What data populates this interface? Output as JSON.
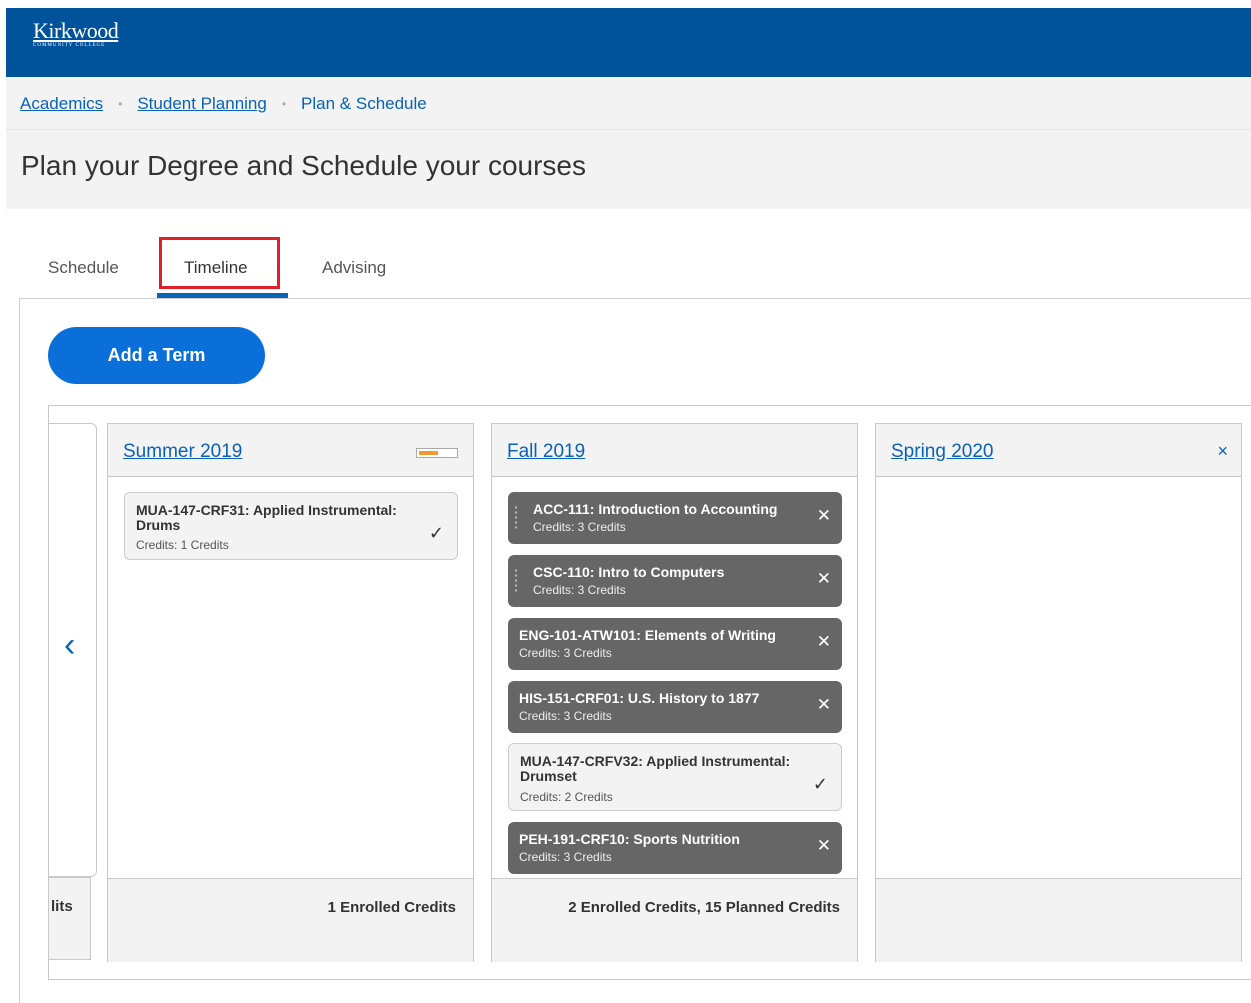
{
  "header": {
    "logo_name": "Kirkwood",
    "logo_sub": "COMMUNITY COLLEGE"
  },
  "breadcrumb": {
    "items": [
      "Academics",
      "Student Planning",
      "Plan & Schedule"
    ]
  },
  "page": {
    "title": "Plan your Degree and Schedule your courses"
  },
  "tabs": [
    {
      "label": "Schedule"
    },
    {
      "label": "Timeline",
      "selected": true
    },
    {
      "label": "Advising"
    }
  ],
  "actions": {
    "add_term": "Add a Term"
  },
  "prev_term": {
    "footer": "lits",
    "arrow_icon": "chevron-left-icon"
  },
  "terms": [
    {
      "name": "Summer 2019",
      "footer": "1 Enrolled Credits",
      "progress_fraction": 0.5,
      "courses": [
        {
          "title": "MUA-147-CRF31: Applied Instrumental: Drums",
          "credits": "Credits: 1 Credits",
          "status": "enrolled"
        }
      ]
    },
    {
      "name": "Fall 2019",
      "footer": "2 Enrolled Credits, 15 Planned Credits",
      "courses": [
        {
          "title": "ACC-111: Introduction to Accounting",
          "credits": "Credits: 3 Credits",
          "status": "planned"
        },
        {
          "title": "CSC-110: Intro to Computers",
          "credits": "Credits: 3 Credits",
          "status": "planned"
        },
        {
          "title": "ENG-101-ATW101: Elements of Writing",
          "credits": "Credits: 3 Credits",
          "status": "planned"
        },
        {
          "title": "HIS-151-CRF01: U.S. History to 1877",
          "credits": "Credits: 3 Credits",
          "status": "planned"
        },
        {
          "title": "MUA-147-CRFV32: Applied Instrumental: Drumset",
          "credits": "Credits: 2 Credits",
          "status": "enrolled"
        },
        {
          "title": "PEH-191-CRF10: Sports Nutrition",
          "credits": "Credits: 3 Credits",
          "status": "planned"
        }
      ]
    },
    {
      "name": "Spring 2020",
      "remove_icon": "×",
      "footer": "",
      "courses": []
    }
  ],
  "colors": {
    "header": "#00539b",
    "accent": "#0a62b8",
    "planned_course": "#666666",
    "highlight": "#e0202a",
    "progress": "#f29a2e"
  }
}
